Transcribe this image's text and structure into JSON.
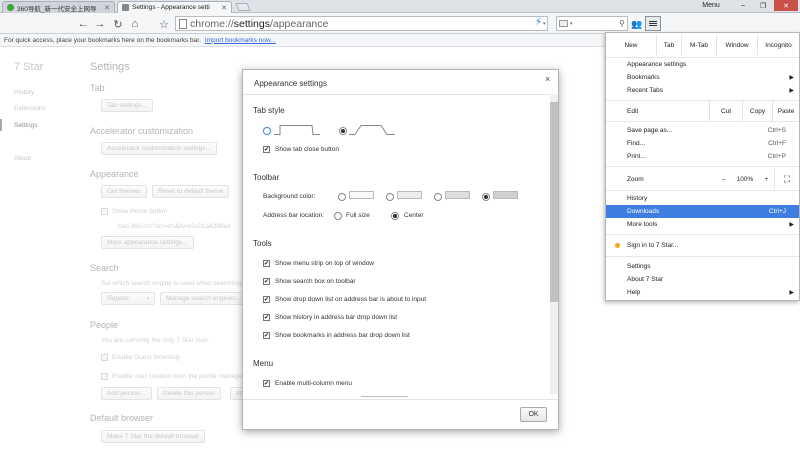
{
  "tabs": [
    {
      "title": "360导航_新一代安全上网导",
      "active": false
    },
    {
      "title": "Settings - Appearance setti",
      "active": true
    }
  ],
  "window": {
    "menu_label": "Menu",
    "minimize": "–",
    "restore": "❐",
    "close": "✕"
  },
  "toolbar": {
    "back": "←",
    "forward": "→",
    "reload": "↻",
    "home": "⌂",
    "star": "☆",
    "url_prefix": "chrome://",
    "url_host": "settings",
    "url_path": "/appearance"
  },
  "bookmarks_bar": {
    "text": "For quick access, place your bookmarks here on the bookmarks bar.",
    "link": "Import bookmarks now..."
  },
  "page": {
    "brand": "7 Star",
    "sidebar": [
      "History",
      "Extensions",
      "Settings",
      "About"
    ],
    "title": "Settings",
    "sections": {
      "tab": "Tab",
      "tab_button": "Tab settings...",
      "accel": "Accelerator customization",
      "accel_button": "Accelerator customization settings...",
      "appearance": "Appearance",
      "get_themes": "Get themes",
      "reset_theme": "Reset to default theme",
      "show_home": "Show Home button",
      "home_url": "hao.360.cn/?src=lm&ls=n3c01a4398a4",
      "more_appearance": "More appearance settings...",
      "search": "Search",
      "search_desc": "Set which search engine is used when searching from the",
      "search_engine": "Яндекс",
      "manage_search": "Manage search engines...",
      "people": "People",
      "people_desc": "You are currently the only 7 Star user.",
      "guest": "Enable Guest browsing",
      "user_creation": "Enable user creation from the profile manager",
      "add_person": "Add person...",
      "delete_person": "Delete this person",
      "import": "Im",
      "default_browser": "Default browser",
      "make_default": "Make 7 Star the default browser"
    }
  },
  "dialog": {
    "title": "Appearance settings",
    "close": "×",
    "tab_style": "Tab style",
    "show_tab_close": "Show tab close button",
    "toolbar": "Toolbar",
    "bg_color_label": "Background color:",
    "addr_loc_label": "Address bar location:",
    "full_size": "Full size",
    "center": "Center",
    "tools": "Tools",
    "tools_items": [
      "Show menu strip on top of window",
      "Show search box on toolbar",
      "Show drop down list on address bar is about to input",
      "Show history in address bar drop down list",
      "Show bookmarks in address bar drop down list"
    ],
    "menu": "Menu",
    "multi_column": "Enable multi-column menu",
    "ok": "OK",
    "check_mark": "✔"
  },
  "menu": {
    "row1": [
      "New",
      "Tab",
      "M-Tab",
      "Window",
      "Incognito"
    ],
    "appearance": "Appearance settings",
    "bookmarks": "Bookmarks",
    "recent_tabs": "Recent Tabs",
    "edit": "Edit",
    "cut": "Cut",
    "copy": "Copy",
    "paste": "Paste",
    "save_page": "Save page as...",
    "save_sc": "Ctrl+S",
    "find": "Find...",
    "find_sc": "Ctrl+F",
    "print": "Print...",
    "print_sc": "Ctrl+P",
    "zoom": "Zoom",
    "zoom_minus": "–",
    "zoom_value": "100%",
    "zoom_plus": "+",
    "fullscreen": "⛶",
    "history": "History",
    "downloads": "Downloads",
    "downloads_sc": "Ctrl+J",
    "more_tools": "More tools",
    "sign_in": "Sign in to 7 Star...",
    "settings": "Settings",
    "about": "About 7 Star",
    "help": "Help",
    "arrow": "▶"
  },
  "colors": {
    "accent": "#3d7ee0",
    "link": "#3367d6",
    "tabstrip": "#dfe3e8"
  }
}
